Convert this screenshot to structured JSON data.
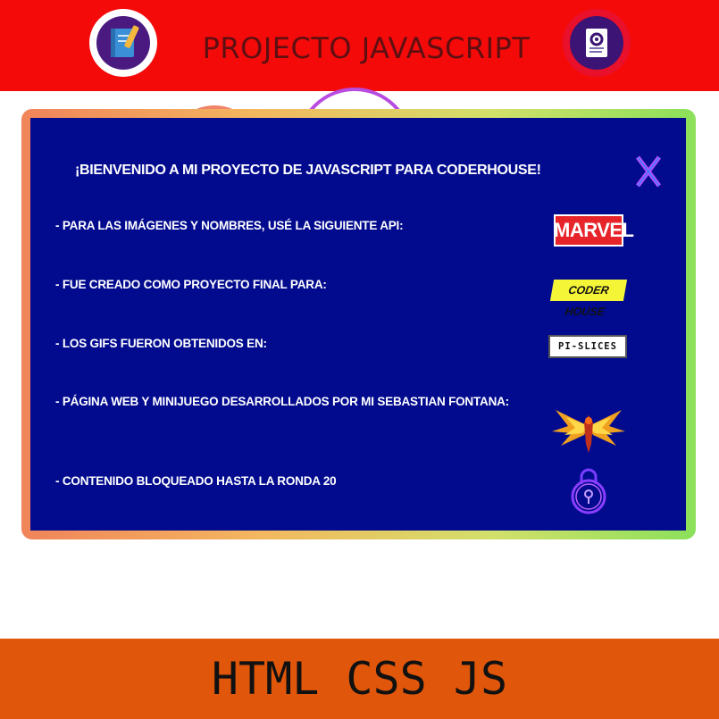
{
  "header": {
    "title": "PROJECTO JAVASCRIPT",
    "left_icon": "notebook-pencil-icon",
    "right_icon": "document-settings-icon"
  },
  "modal": {
    "title": "¡BIENVENIDO A MI PROYECTO DE JAVASCRIPT PARA CODERHOUSE!",
    "close_label": "X",
    "rows": [
      {
        "text": "- PARA LAS IMÁGENES Y NOMBRES, USÉ LA SIGUIENTE API:",
        "logo_text": "MARVEL"
      },
      {
        "text": "- FUE CREADO COMO PROYECTO FINAL PARA:",
        "logo_text": "CODER HOUSE"
      },
      {
        "text": "- LOS GIFS FUERON OBTENIDOS EN:",
        "logo_text": "PI-SLICES"
      },
      {
        "text": "- PÁGINA WEB Y MINIJUEGO DESARROLLADOS POR MI SEBASTIAN FONTANA:",
        "logo_icon": "phoenix-icon"
      },
      {
        "text": "- CONTENIDO BLOQUEADO HASTA LA RONDA 20",
        "logo_icon": "lock-icon"
      }
    ]
  },
  "footer": {
    "text": "HTML CSS JS"
  },
  "colors": {
    "header_bg": "#f50a0a",
    "modal_bg": "#020b8e",
    "footer_bg": "#e0560a",
    "title_text": "#5e0f11"
  }
}
